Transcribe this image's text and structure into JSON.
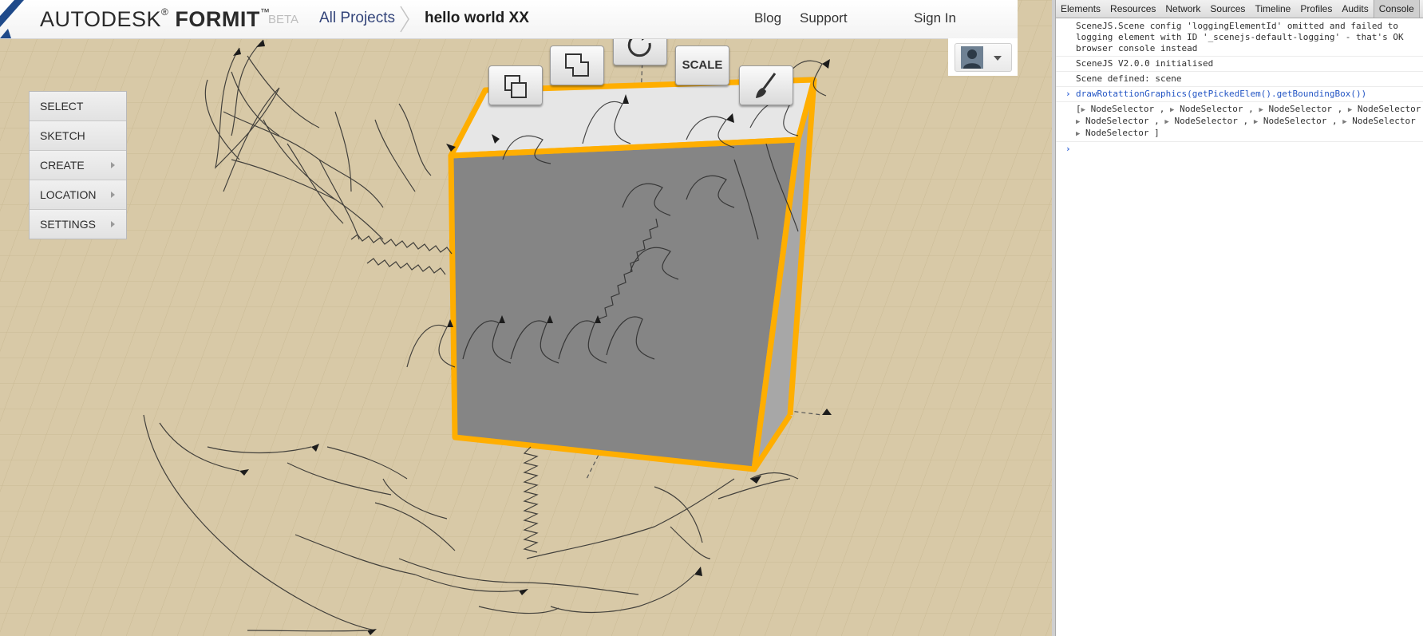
{
  "header": {
    "brand": {
      "prefix": "AUTODESK",
      "reg": "®",
      "name": "FORMIT",
      "tm": "™",
      "badge": "BETA"
    },
    "breadcrumb": {
      "all_projects": "All Projects",
      "project": "hello world XX"
    },
    "nav": {
      "blog": "Blog",
      "support": "Support",
      "sign_in": "Sign In"
    },
    "user_menu": {
      "avatar_icon": "user-silhouette-icon",
      "dropdown_icon": "caret-down-icon"
    }
  },
  "side_menu": {
    "items": [
      {
        "label": "SELECT",
        "submenu": false
      },
      {
        "label": "SKETCH",
        "submenu": false
      },
      {
        "label": "CREATE",
        "submenu": true
      },
      {
        "label": "LOCATION",
        "submenu": true
      },
      {
        "label": "SETTINGS",
        "submenu": true
      }
    ]
  },
  "tool_buttons": {
    "copy": {
      "icon": "copy-squares-icon"
    },
    "move": {
      "icon": "move-shape-icon"
    },
    "rotate": {
      "icon": "rotate-arrow-icon"
    },
    "scale": {
      "label": "SCALE"
    },
    "paint": {
      "icon": "paintbrush-icon"
    }
  },
  "colors": {
    "ground": "#d8c9a7",
    "grid_line": "#c9b993",
    "selection_outline": "#ffae00",
    "cube_front": "#858585",
    "cube_side": "#a7a7a7",
    "cube_top": "#e6e6e6",
    "console_command": "#2355c4"
  },
  "devtools": {
    "tabs": [
      "Elements",
      "Resources",
      "Network",
      "Sources",
      "Timeline",
      "Profiles",
      "Audits",
      "Console"
    ],
    "active_tab": "Console",
    "console": {
      "msg1": [
        "SceneJS.Scene config 'loggingElementId' omitted and failed to",
        "logging element with ID '_scenejs-default-logging' - that's OK",
        "browser console instead"
      ],
      "msg2": "SceneJS V2.0.0 initialised",
      "msg3": "Scene defined: scene",
      "command": "drawRotattionGraphics(getPickedElem().getBoundingBox())",
      "result": {
        "open": "[",
        "item": "NodeSelector",
        "close": "]"
      },
      "prompt": "›"
    }
  }
}
